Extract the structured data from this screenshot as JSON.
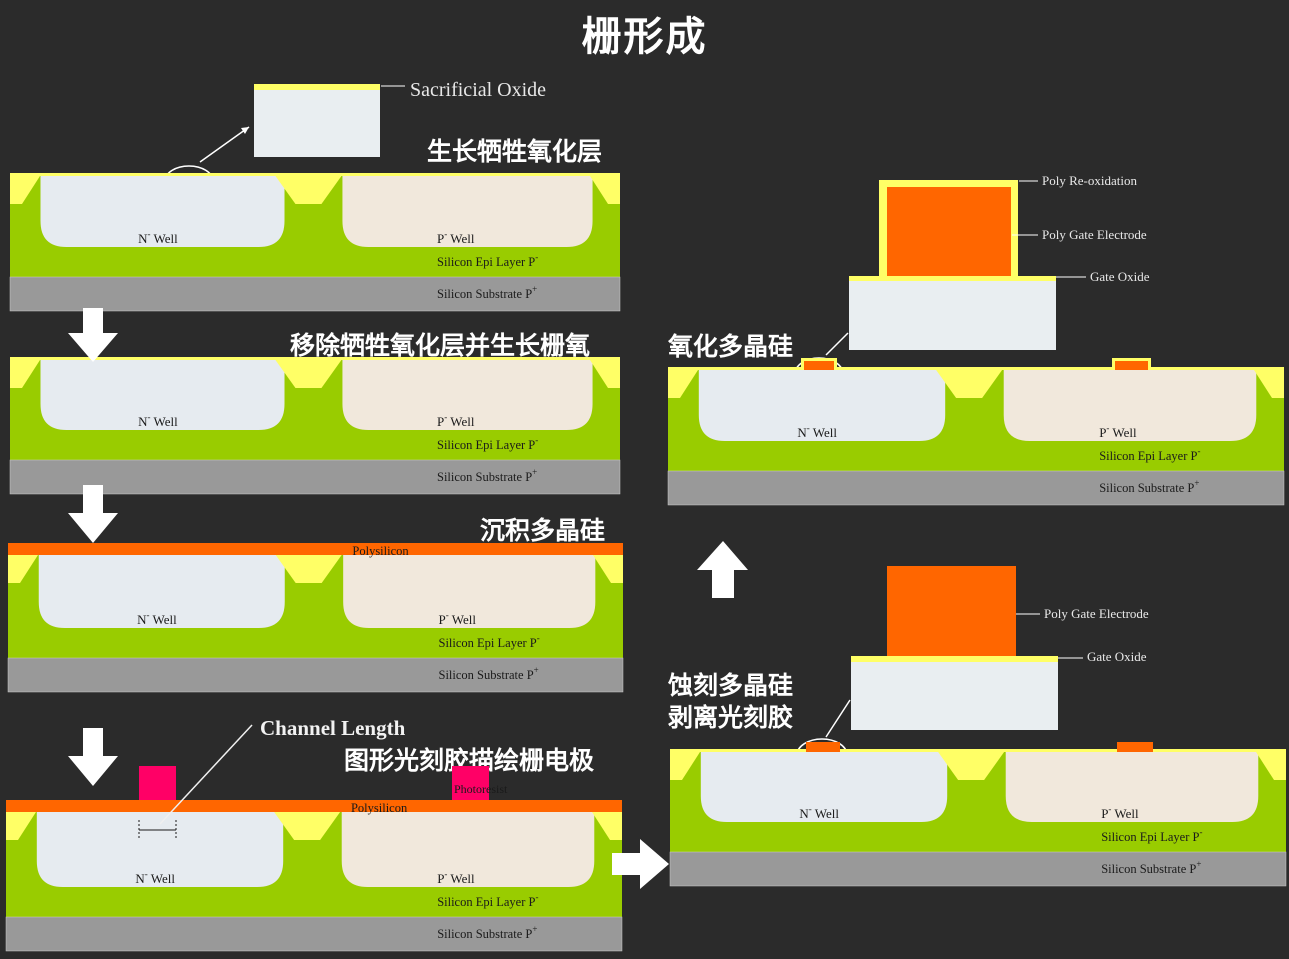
{
  "title": "栅形成",
  "steps": {
    "s1": "生长牺牲氧化层",
    "s2": "移除牺牲氧化层并生长栅氧",
    "s3": "沉积多晶硅",
    "s4": "图形光刻胶描绘栅电极",
    "s5_line1": "蚀刻多晶硅",
    "s5_line2": "剥离光刻胶",
    "s6": "氧化多晶硅"
  },
  "callouts": {
    "sacrificial_oxide": "Sacrificial Oxide",
    "channel_length": "Channel Length",
    "poly_reox": "Poly Re-oxidation",
    "poly_gate_electrode": "Poly Gate Electrode",
    "gate_oxide": "Gate Oxide"
  },
  "layers": {
    "n_well": "N",
    "p_well": "P",
    "well_suffix": "Well",
    "sup_minus": "-",
    "sup_plus": "+",
    "epi": "Silicon Epi Layer  P",
    "substrate": "Silicon Substrate  P",
    "polysilicon": "Polysilicon",
    "photoresist": "Photoresist"
  },
  "colors": {
    "background": "#2b2b2b",
    "epi_green": "#99cc00",
    "substrate_gray": "#999999",
    "n_well": "#e6ebf0",
    "p_well": "#f1e8dc",
    "oxide_yellow": "#ffff66",
    "poly_orange": "#ff6600",
    "photoresist_pink": "#ff0066",
    "arrow_white": "#ffffff"
  }
}
